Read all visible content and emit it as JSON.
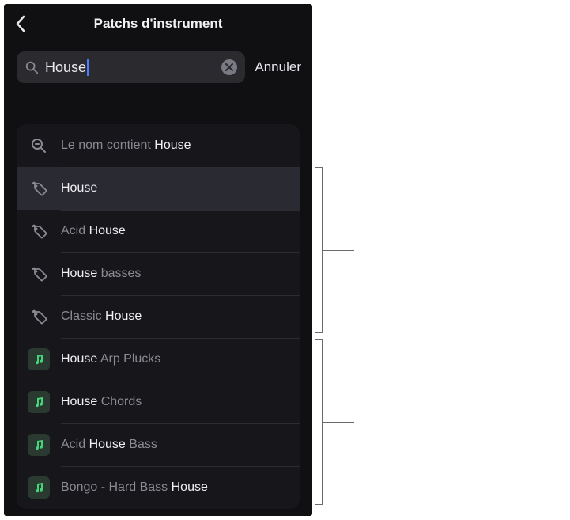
{
  "header": {
    "title": "Patchs d'instrument"
  },
  "search": {
    "value": "House",
    "cancel": "Annuler"
  },
  "results": {
    "name_contains_prefix": "Le nom contient ",
    "name_contains_term": "House",
    "tags": [
      {
        "label": "House",
        "match": "House",
        "selected": true
      },
      {
        "label": "Acid House",
        "match": "House",
        "prefix": "Acid "
      },
      {
        "label": "House basses",
        "match": "House",
        "suffix": " basses"
      },
      {
        "label": "Classic House",
        "match": "House",
        "prefix": "Classic "
      }
    ],
    "patches": [
      {
        "label": "House Arp Plucks",
        "match": "House",
        "suffix": " Arp Plucks"
      },
      {
        "label": "House Chords",
        "match": "House",
        "suffix": " Chords"
      },
      {
        "label": "Acid House Bass",
        "match": "House",
        "prefix": "Acid ",
        "suffix": " Bass"
      },
      {
        "label": "Bongo - Hard Bass House",
        "match": "House",
        "prefix": "Bongo - Hard Bass "
      }
    ]
  }
}
